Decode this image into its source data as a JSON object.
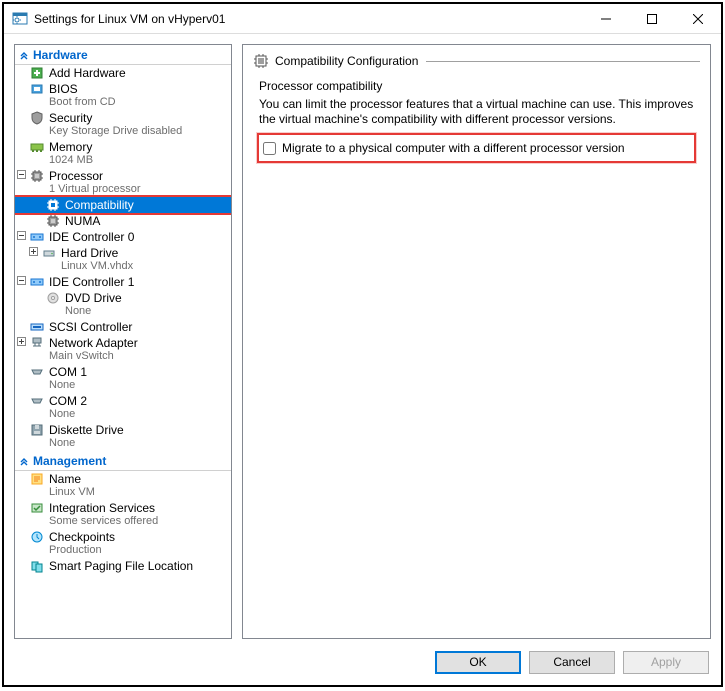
{
  "window": {
    "title": "Settings for Linux VM on vHyperv01"
  },
  "sections": {
    "hardware": "Hardware",
    "management": "Management"
  },
  "tree": {
    "add_hardware": "Add Hardware",
    "bios": {
      "label": "BIOS",
      "sub": "Boot from CD"
    },
    "security": {
      "label": "Security",
      "sub": "Key Storage Drive disabled"
    },
    "memory": {
      "label": "Memory",
      "sub": "1024 MB"
    },
    "processor": {
      "label": "Processor",
      "sub": "1 Virtual processor"
    },
    "compatibility": "Compatibility",
    "numa": "NUMA",
    "ide0": {
      "label": "IDE Controller 0"
    },
    "hard_drive": {
      "label": "Hard Drive",
      "sub": "Linux VM.vhdx"
    },
    "ide1": {
      "label": "IDE Controller 1"
    },
    "dvd": {
      "label": "DVD Drive",
      "sub": "None"
    },
    "scsi": {
      "label": "SCSI Controller"
    },
    "net": {
      "label": "Network Adapter",
      "sub": "Main vSwitch"
    },
    "com1": {
      "label": "COM 1",
      "sub": "None"
    },
    "com2": {
      "label": "COM 2",
      "sub": "None"
    },
    "diskette": {
      "label": "Diskette Drive",
      "sub": "None"
    },
    "name": {
      "label": "Name",
      "sub": "Linux VM"
    },
    "integration": {
      "label": "Integration Services",
      "sub": "Some services offered"
    },
    "checkpoints": {
      "label": "Checkpoints",
      "sub": "Production"
    },
    "smartpaging": {
      "label": "Smart Paging File Location"
    }
  },
  "right": {
    "group_title": "Compatibility Configuration",
    "section_label": "Processor compatibility",
    "description": "You can limit the processor features that a virtual machine can use. This improves the virtual machine's compatibility with different processor versions.",
    "checkbox_label": "Migrate to a physical computer with a different processor version"
  },
  "buttons": {
    "ok": "OK",
    "cancel": "Cancel",
    "apply": "Apply"
  }
}
